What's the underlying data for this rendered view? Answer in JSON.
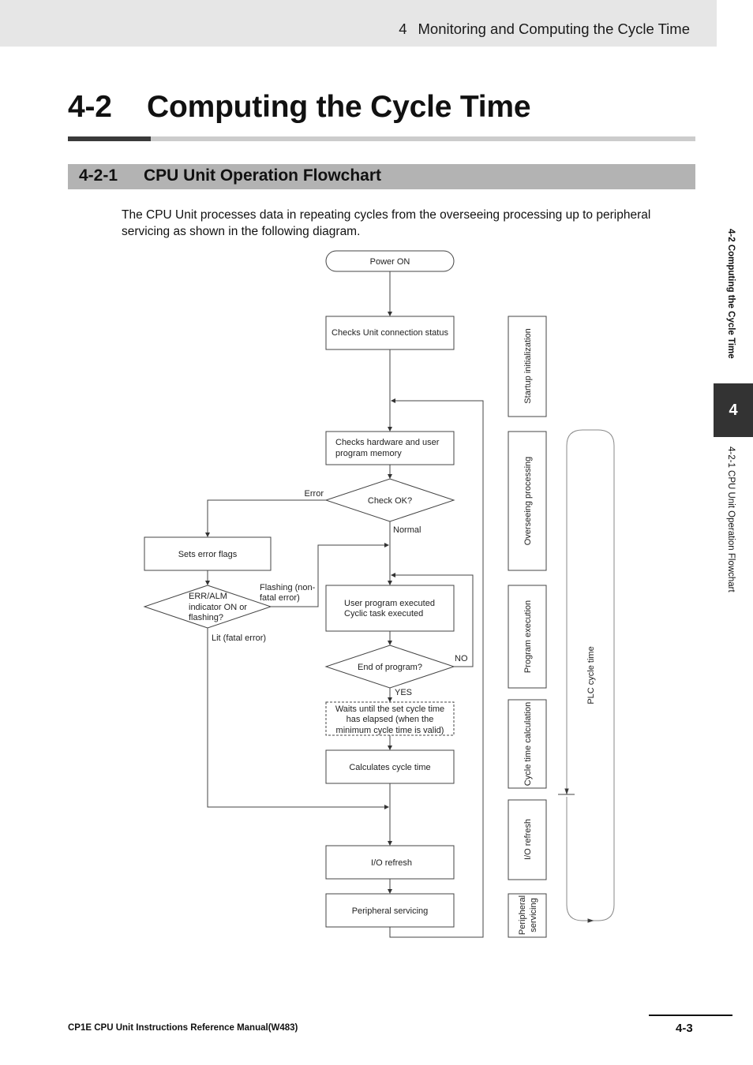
{
  "header": {
    "chapter_number": "4",
    "chapter_title": "Monitoring and Computing the Cycle Time"
  },
  "title": {
    "number": "4-2",
    "text": "Computing the Cycle Time"
  },
  "section": {
    "number": "4-2-1",
    "text": "CPU Unit Operation Flowchart"
  },
  "intro": "The CPU Unit processes data in repeating cycles from the overseeing processing up to peripheral servicing as shown in the following diagram.",
  "side_tab": {
    "section_label": "4-2 Computing the Cycle Time",
    "chapter_number": "4",
    "subsection_label": "4-2-1  CPU Unit Operation Flowchart"
  },
  "flowchart": {
    "nodes": {
      "power_on": "Power ON",
      "check_connection": "Checks Unit connection status",
      "check_memory": [
        "Checks hardware and user",
        "program memory"
      ],
      "check_ok": "Check OK?",
      "sets_error_flags": "Sets error flags",
      "err_alm": [
        "ERR/ALM",
        "indicator ON or",
        "flashing?"
      ],
      "user_program": [
        "User program executed",
        "Cyclic task executed"
      ],
      "end_of_program": "End of program?",
      "waits": [
        "Waits until the set cycle time",
        "has elapsed (when the",
        "minimum cycle time is valid)"
      ],
      "calculates_cycle": "Calculates cycle time",
      "io_refresh": "I/O refresh",
      "peripheral_servicing": "Peripheral servicing"
    },
    "edge_labels": {
      "error": "Error",
      "normal": "Normal",
      "flashing": [
        "Flashing (non-",
        "fatal error)"
      ],
      "lit": "Lit (fatal error)",
      "no": "NO",
      "yes": "YES"
    },
    "phases": {
      "startup": "Startup initialization",
      "overseeing": "Overseeing processing",
      "program_execution": "Program execution",
      "cycle_time_calc": "Cycle time calculation",
      "io_refresh": "I/O refresh",
      "peripheral": [
        "Peripheral",
        "servicing"
      ]
    },
    "plc_cycle_time": "PLC cycle time"
  },
  "footer": {
    "manual_title": "CP1E CPU Unit Instructions Reference Manual(W483)",
    "page_number": "4-3"
  }
}
